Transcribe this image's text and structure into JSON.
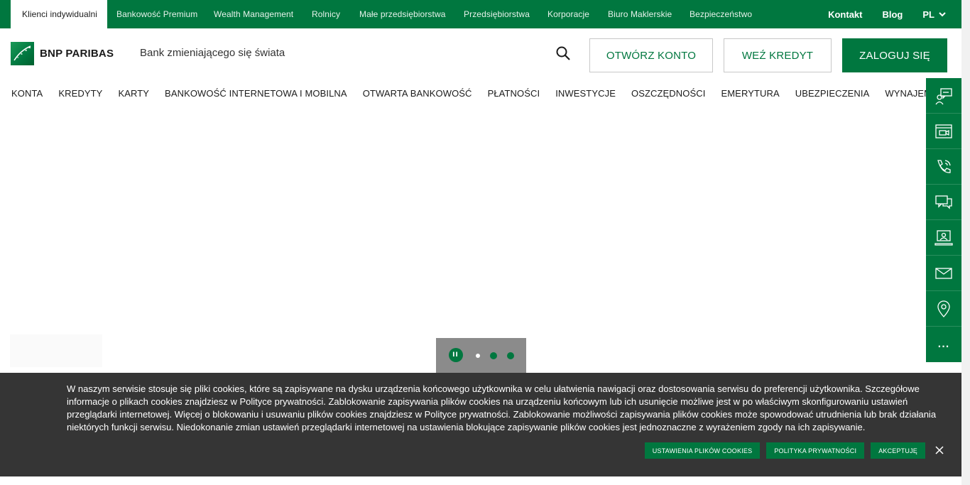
{
  "topbar": {
    "segments": [
      "Klienci indywidualni",
      "Bankowość Premium",
      "Wealth Management",
      "Rolnicy",
      "Małe przedsiębiorstwa",
      "Przedsiębiorstwa",
      "Korporacje",
      "Biuro Maklerskie",
      "Bezpieczeństwo"
    ],
    "contact": "Kontakt",
    "blog": "Blog",
    "language": "PL"
  },
  "header": {
    "logo_text": "BNP PARIBAS",
    "tagline": "Bank zmieniającego się świata",
    "open_account": "OTWÓRZ KONTO",
    "take_loan": "WEŹ KREDYT",
    "login": "ZALOGUJ SIĘ"
  },
  "nav": {
    "items": [
      "KONTA",
      "KREDYTY",
      "KARTY",
      "BANKOWOŚĆ INTERNETOWA I MOBILNA",
      "OTWARTA BANKOWOŚĆ",
      "PŁATNOŚCI",
      "INWESTYCJE",
      "OSZCZĘDNOŚCI",
      "EMERYTURA",
      "UBEZPIECZENIA",
      "WYNAJEM"
    ]
  },
  "rail": {
    "icons": [
      "advisor-chat-icon",
      "video-call-icon",
      "phone-icon",
      "chat-icon",
      "online-advisor-icon",
      "mail-icon",
      "location-pin-icon"
    ],
    "more": "..."
  },
  "carousel": {
    "pause_label": "II"
  },
  "cookie": {
    "text": "W naszym serwisie stosuje się pliki cookies, które są zapisywane na dysku urządzenia końcowego użytkownika w celu ułatwienia nawigacji oraz dostosowania serwisu do preferencji użytkownika. Szczegółowe informacje o plikach cookies znajdziesz w Polityce prywatności. Zablokowanie zapisywania plików cookies na urządzeniu końcowym lub ich usunięcie możliwe jest w po właściwym skonfigurowaniu ustawień przeglądarki internetowej. Więcej o blokowaniu i usuwaniu plików cookies znajdziesz w Polityce prywatności. Zablokowanie możliwości zapisywania plików cookies może spowodować utrudnienia lub brak działania niektórych funkcji serwisu. Niedokonanie zmian ustawień przeglądarki internetowej na ustawienia blokujące zapisywanie plików cookies jest jednoznaczne z wyrażeniem zgody na ich zapisywanie.",
    "settings_label": "USTAWIENIA PLIKÓW COOKIES",
    "privacy_label": "POLITYKA PRYWATNOŚCI",
    "accept_label": "AKCEPTUJĘ"
  },
  "colors": {
    "brand_green": "#00773f",
    "banner_bg": "#353535"
  }
}
